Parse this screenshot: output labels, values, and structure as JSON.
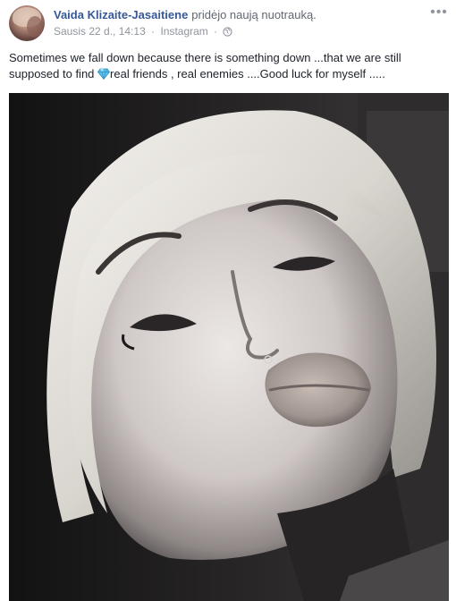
{
  "post": {
    "author_name": "Vaida Klizaite-Jasaitiene",
    "action_text": "pridėjo naują nuotrauką.",
    "timestamp": "Sausis 22 d., 14:13",
    "separator": "·",
    "source": "Instagram",
    "separator2": "·",
    "audience_icon": "globe-icon",
    "more_options_icon": "more-horizontal-icon",
    "more_options_glyph": "•••",
    "caption_part1": "Sometimes we fall down because there is something down ...that we are still supposed to find ",
    "caption_emoji_icon": "gem-icon",
    "caption_part2": "real friends , real enemies ....Good luck for myself .....",
    "photo_subject": "black-and-white selfie of a woman with a blonde bob making a kissing face"
  },
  "colors": {
    "author_link": "#365899",
    "meta_gray": "#90949c",
    "text": "#1d2129",
    "gem": "#5bc0eb"
  }
}
